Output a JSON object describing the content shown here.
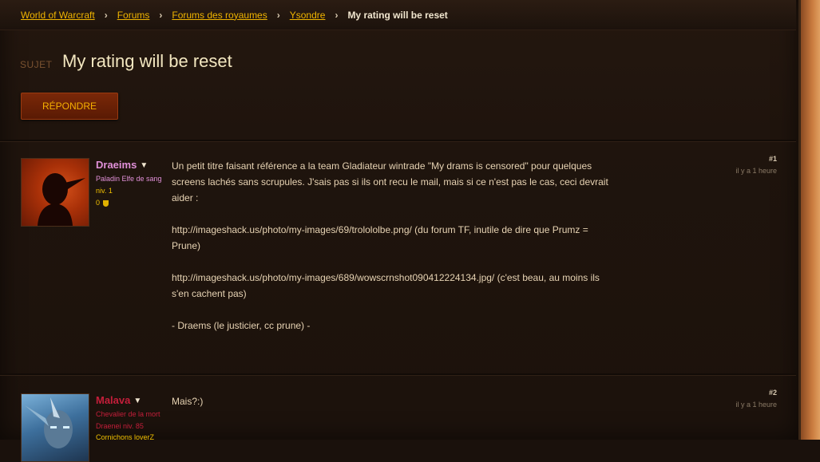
{
  "breadcrumb": {
    "items": [
      "World of Warcraft",
      "Forums",
      "Forums des royaumes",
      "Ysondre"
    ],
    "current": "My rating will be reset",
    "separator": "›"
  },
  "topic": {
    "tag": "SUJET",
    "title": "My rating will be reset"
  },
  "reply_button": "RÉPONDRE",
  "posts": [
    {
      "author": "Draeims",
      "author_color": "#e090d8",
      "class_race": "Paladin Elfe de sang",
      "level": "niv. 1",
      "achievements": "0",
      "number": "#1",
      "time": "il y a 1 heure",
      "paragraphs": [
        "Un petit titre faisant référence a la team Gladiateur wintrade \"My drams is censored\" pour quelques screens lachés sans scrupules. J'sais pas si ils ont recu le mail, mais si ce n'est pas le cas, ceci devrait aider :",
        "http://imageshack.us/photo/my-images/69/trolololbe.png/ (du forum TF, inutile de dire que Prumz = Prune)",
        "http://imageshack.us/photo/my-images/689/wowscrnshot090412224134.jpg/ (c'est beau, au moins ils s'en cachent pas)",
        "- Draems (le justicier, cc prune) -"
      ]
    },
    {
      "author": "Malava",
      "author_color": "#c41e3a",
      "class_race": "Chevalier de la mort",
      "level": "Draenei niv. 85",
      "guild": "Cornichons loverZ",
      "number": "#2",
      "time": "il y a 1 heure",
      "paragraphs": [
        "Mais?:)"
      ]
    }
  ]
}
